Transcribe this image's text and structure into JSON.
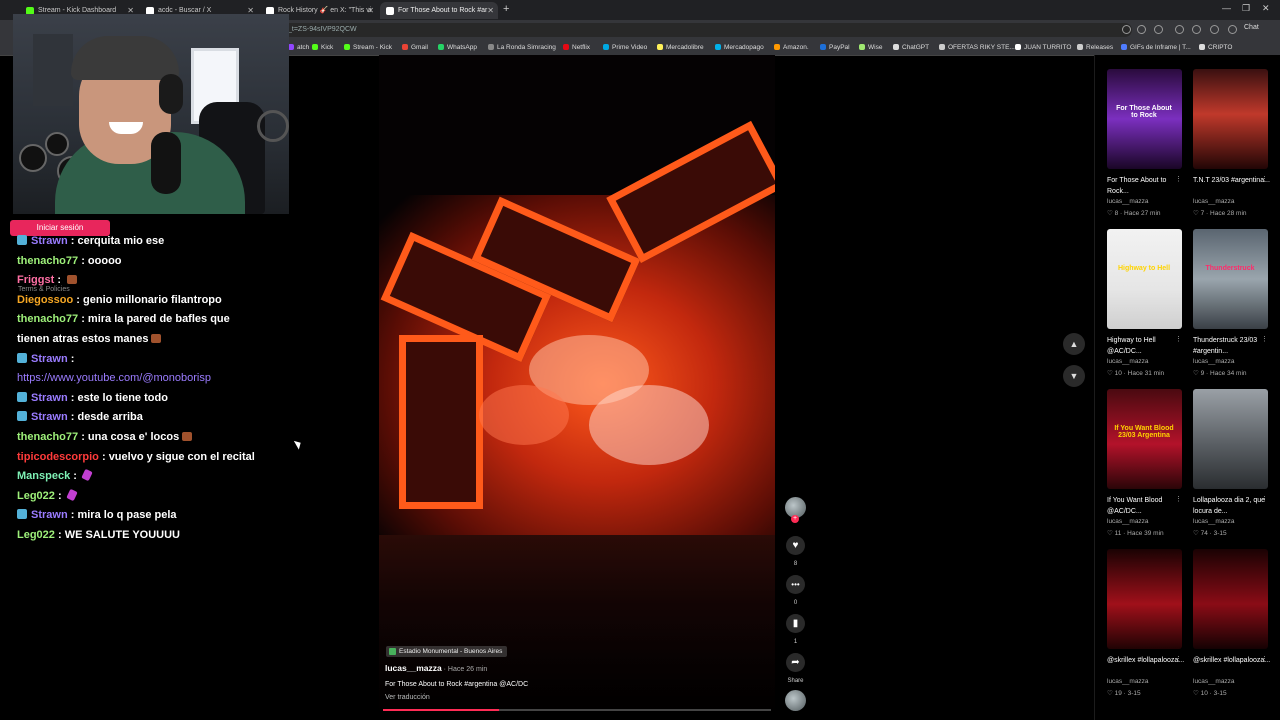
{
  "tabs": [
    {
      "label": "Stream - Kick Dashboard",
      "color": "#53fc18"
    },
    {
      "label": "acdc - Buscar / X",
      "color": "#ffffff"
    },
    {
      "label": "Rock History 🎸 en X: \"This vi",
      "color": "#ffffff"
    },
    {
      "label": "For Those About to Rock #ar",
      "color": "#ffffff"
    }
  ],
  "url": "_t=ZS-94sIVP92QCW",
  "browser_chat_label": "Chat",
  "bookmarks": [
    {
      "label": "atch",
      "color": "#9146ff"
    },
    {
      "label": "Kick",
      "color": "#53fc18"
    },
    {
      "label": "Stream - Kick",
      "color": "#53fc18"
    },
    {
      "label": "Gmail",
      "color": "#ea4335"
    },
    {
      "label": "WhatsApp",
      "color": "#25d366"
    },
    {
      "label": "La Ronda Simracing",
      "color": "#888888"
    },
    {
      "label": "Netflix",
      "color": "#e50914"
    },
    {
      "label": "Prime Video",
      "color": "#00a8e1"
    },
    {
      "label": "Mercadolibre",
      "color": "#fff159"
    },
    {
      "label": "Mercadopago",
      "color": "#00b1ea"
    },
    {
      "label": "Amazon.",
      "color": "#ff9900"
    },
    {
      "label": "PayPal",
      "color": "#1d6fd8"
    },
    {
      "label": "Wise",
      "color": "#9fe870"
    },
    {
      "label": "ChatGPT",
      "color": "#dddddd"
    },
    {
      "label": "OFERTAS RIKY STE...",
      "color": "#cccccc"
    },
    {
      "label": "JUAN TURRITO",
      "color": "#ffffff"
    },
    {
      "label": "Releases",
      "color": "#cccccc"
    },
    {
      "label": "GIFs de Inframe | T...",
      "color": "#4f7cff"
    },
    {
      "label": "CRIPTO",
      "color": "#dddddd"
    }
  ],
  "login_button": "Iniciar sesión",
  "terms_label": "Terms & Policies",
  "chat": [
    {
      "user": "Strawn",
      "color": "#9a7cff",
      "badge": true,
      "text": "cerquita mio ese"
    },
    {
      "user": "thenacho77",
      "color": "#9ef07a",
      "badge": false,
      "text": "ooooo"
    },
    {
      "user": "Friggst",
      "color": "#ff6fa4",
      "badge": false,
      "text": "",
      "emote": true
    },
    {
      "user": "Diegossoo",
      "color": "#f5a623",
      "badge": false,
      "text": "genio millonario filantropo"
    },
    {
      "user": "thenacho77",
      "color": "#9ef07a",
      "badge": false,
      "text": "mira la pared de bafles que tienen atras estos manes",
      "emote": true
    },
    {
      "user": "Strawn",
      "color": "#9a7cff",
      "badge": true,
      "text": "",
      "link": "https://www.youtube.com/@monoborisp"
    },
    {
      "user": "Strawn",
      "color": "#9a7cff",
      "badge": true,
      "text": "este lo tiene todo"
    },
    {
      "user": "Strawn",
      "color": "#9a7cff",
      "badge": true,
      "text": "desde arriba"
    },
    {
      "user": "thenacho77",
      "color": "#9ef07a",
      "badge": false,
      "text": "una cosa e' locos",
      "emote": true
    },
    {
      "user": "tipicodescorpio",
      "color": "#ff3b3b",
      "badge": false,
      "text": "vuelvo y sigue con el recital"
    },
    {
      "user": "Manspeck",
      "color": "#7ef0b5",
      "badge": false,
      "text": "",
      "pin": true
    },
    {
      "user": "Leg022",
      "color": "#9ef07a",
      "badge": false,
      "text": "",
      "pin": true
    },
    {
      "user": "Strawn",
      "color": "#9a7cff",
      "badge": true,
      "text": "mira lo q pase pela"
    },
    {
      "user": "Leg022",
      "color": "#9ef07a",
      "badge": false,
      "text": "WE SALUTE YOUUUU"
    }
  ],
  "video": {
    "location": "Estadio Monumental - Buenos Aires",
    "author": "lucas__mazza",
    "time": " · Hace 26 min",
    "description": "For Those About to Rock #argentina @AC/DC",
    "translate": "Ver traducción",
    "progress_percent": 30
  },
  "actions": {
    "likes": "8",
    "comments": "0",
    "saves": "1",
    "share": "Share"
  },
  "related": [
    {
      "title": "For Those About to Rock...",
      "author": "lucas__mazza",
      "stats": "♡ 8 · Hace 27 min",
      "thumb_text": "For Those About to Rock",
      "thumb_text_color": "#ffffff",
      "bg": "linear-gradient(180deg,#2a0b3d,#7b2fbf 50%,#1a0626)"
    },
    {
      "title": "T.N.T 23/03 #argentina...",
      "author": "lucas__mazza",
      "stats": "♡ 7 · Hace 28 min",
      "thumb_text": "",
      "thumb_text_color": "#ffffff",
      "bg": "linear-gradient(180deg,#3a1010,#c0392b 45%,#220606)"
    },
    {
      "title": "Highway to Hell @AC/DC...",
      "author": "lucas__mazza",
      "stats": "♡ 10 · Hace 31 min",
      "thumb_text": "Highway to Hell",
      "thumb_text_color": "#ffd400",
      "bg": "linear-gradient(180deg,#f2f2f2,#e6e6e6 60%,#cfcfcf)"
    },
    {
      "title": "Thunderstruck 23/03 #argentin...",
      "author": "lucas__mazza",
      "stats": "♡ 9 · Hace 34 min",
      "thumb_text": "Thunderstruck",
      "thumb_text_color": "#ff2a6a",
      "bg": "linear-gradient(180deg,#5a6570,#9aa5ad 50%,#3a4046)"
    },
    {
      "title": "If You Want Blood @AC/DC...",
      "author": "lucas__mazza",
      "stats": "♡ 11 · Hace 39 min",
      "thumb_text": "If You Want Blood 23/03 Argentina",
      "thumb_text_color": "#ffd400",
      "bg": "linear-gradient(180deg,#4a0a10,#b3122a 55%,#2a0508)"
    },
    {
      "title": "Lollapalooza dia 2, que locura de...",
      "author": "lucas__mazza",
      "stats": "♡ 74 · 3-15",
      "thumb_text": "",
      "thumb_text_color": "#ffffff",
      "bg": "linear-gradient(180deg,#9aa0a6,#5a5f64 55%,#2a2d30)"
    },
    {
      "title": "@skrillex #lollapalooza...",
      "author": "lucas__mazza",
      "stats": "♡ 19 · 3-15",
      "thumb_text": "",
      "thumb_text_color": "#ffffff",
      "bg": "linear-gradient(180deg,#1a0203,#a0101a 55%,#200304)"
    },
    {
      "title": "@skrillex #lollapalooza...",
      "author": "lucas__mazza",
      "stats": "♡ 10 · 3-15",
      "thumb_text": "",
      "thumb_text_color": "#ffffff",
      "bg": "linear-gradient(180deg,#1a0203,#8a0c16 55%,#150203)"
    }
  ]
}
